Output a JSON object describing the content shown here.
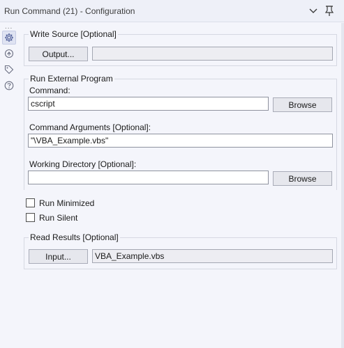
{
  "window": {
    "title": "Run Command (21) - Configuration"
  },
  "rail": {
    "dots": "...",
    "icons": [
      "gear-icon",
      "refresh-icon",
      "tag-icon",
      "help-icon"
    ]
  },
  "write_source": {
    "title": "Write Source [Optional]",
    "output_button": "Output...",
    "path_value": ""
  },
  "run_external": {
    "title": "Run External Program",
    "command_label": "Command:",
    "command_value": "cscript",
    "browse_label": "Browse",
    "args_label": "Command Arguments [Optional]:",
    "args_value": "\"\\VBA_Example.vbs\"",
    "workdir_label": "Working Directory [Optional]:",
    "workdir_value": "",
    "browse2_label": "Browse"
  },
  "options": {
    "run_minimized_label": "Run Minimized",
    "run_minimized_checked": false,
    "run_silent_label": "Run Silent",
    "run_silent_checked": false
  },
  "read_results": {
    "title": "Read Results [Optional]",
    "input_button": "Input...",
    "file_value": "VBA_Example.vbs"
  },
  "colors": {
    "background": "#f4f5fb",
    "accent": "#5b6aa8"
  }
}
